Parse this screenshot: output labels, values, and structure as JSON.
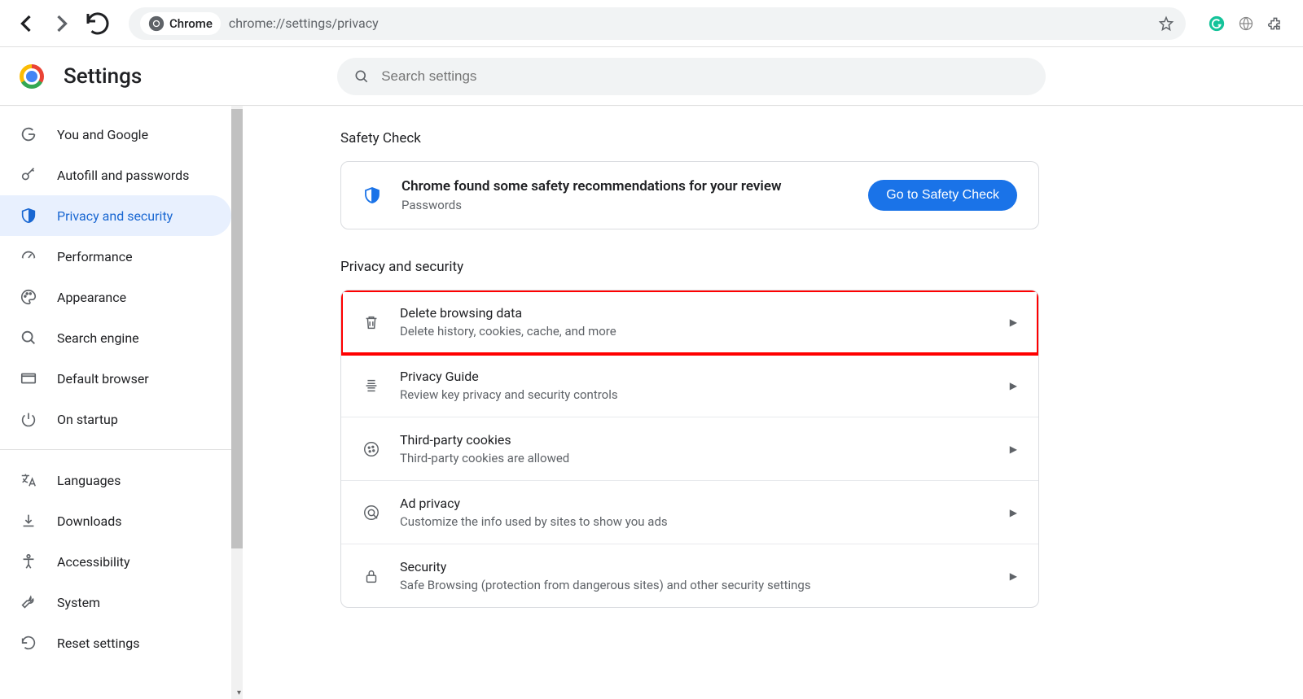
{
  "browser": {
    "chrome_label": "Chrome",
    "url": "chrome://settings/privacy"
  },
  "page_title": "Settings",
  "search_placeholder": "Search settings",
  "sidebar": {
    "group1": [
      {
        "label": "You and Google",
        "icon": "g-icon"
      },
      {
        "label": "Autofill and passwords",
        "icon": "key-icon"
      },
      {
        "label": "Privacy and security",
        "icon": "shield-icon",
        "selected": true
      },
      {
        "label": "Performance",
        "icon": "speed-icon"
      },
      {
        "label": "Appearance",
        "icon": "palette-icon"
      },
      {
        "label": "Search engine",
        "icon": "search-icon"
      },
      {
        "label": "Default browser",
        "icon": "window-icon"
      },
      {
        "label": "On startup",
        "icon": "power-icon"
      }
    ],
    "group2": [
      {
        "label": "Languages",
        "icon": "translate-icon"
      },
      {
        "label": "Downloads",
        "icon": "download-icon"
      },
      {
        "label": "Accessibility",
        "icon": "accessibility-icon"
      },
      {
        "label": "System",
        "icon": "wrench-icon"
      },
      {
        "label": "Reset settings",
        "icon": "reset-icon"
      }
    ]
  },
  "safety": {
    "section_label": "Safety Check",
    "title": "Chrome found some safety recommendations for your review",
    "sub": "Passwords",
    "button": "Go to Safety Check"
  },
  "privacy": {
    "section_label": "Privacy and security",
    "rows": [
      {
        "title": "Delete browsing data",
        "sub": "Delete history, cookies, cache, and more",
        "icon": "trash-icon",
        "highlight": true
      },
      {
        "title": "Privacy Guide",
        "sub": "Review key privacy and security controls",
        "icon": "guide-icon"
      },
      {
        "title": "Third-party cookies",
        "sub": "Third-party cookies are allowed",
        "icon": "cookie-icon"
      },
      {
        "title": "Ad privacy",
        "sub": "Customize the info used by sites to show you ads",
        "icon": "ad-icon"
      },
      {
        "title": "Security",
        "sub": "Safe Browsing (protection from dangerous sites) and other security settings",
        "icon": "lock-icon"
      }
    ]
  }
}
